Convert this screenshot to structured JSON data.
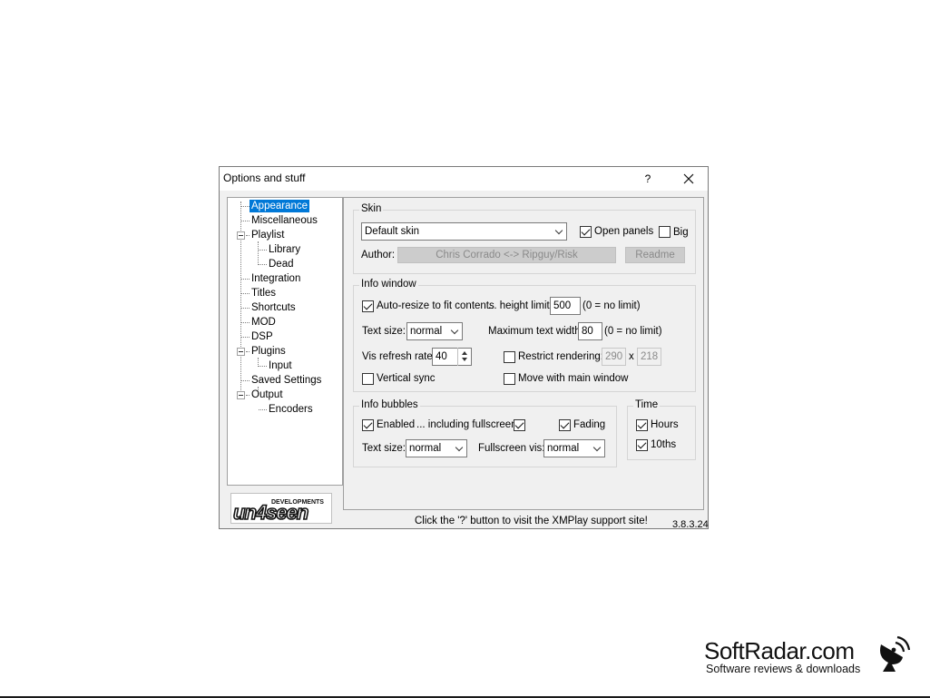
{
  "window": {
    "title": "Options and stuff",
    "help": "?",
    "close": "close"
  },
  "tree": {
    "items": [
      {
        "label": "Appearance",
        "selected": true
      },
      {
        "label": "Miscellaneous"
      },
      {
        "label": "Playlist"
      },
      {
        "label": "Library"
      },
      {
        "label": "Dead"
      },
      {
        "label": "Integration"
      },
      {
        "label": "Titles"
      },
      {
        "label": "Shortcuts"
      },
      {
        "label": "MOD"
      },
      {
        "label": "DSP"
      },
      {
        "label": "Plugins"
      },
      {
        "label": "Input"
      },
      {
        "label": "Saved Settings"
      },
      {
        "label": "Output"
      },
      {
        "label": "Encoders"
      }
    ]
  },
  "logo": {
    "top_text": "DEVELOPMENTS",
    "main_text": "un4seen"
  },
  "skin": {
    "group_label": "Skin",
    "selected": "Default skin",
    "open_panels_label": "Open panels",
    "open_panels_checked": true,
    "big_label": "Big",
    "big_checked": false,
    "author_label": "Author:",
    "author_value": "Chris Corrado <-> Ripguy/Risk",
    "readme_label": "Readme"
  },
  "info_window": {
    "group_label": "Info window",
    "auto_resize_label": "Auto-resize to fit contents",
    "auto_resize_checked": true,
    "height_limit_label": "... height limit:",
    "height_limit_value": "500",
    "no_limit_note": "(0 = no limit)",
    "text_size_label": "Text size:",
    "text_size_value": "normal",
    "max_width_label": "Maximum text width:",
    "max_width_value": "80",
    "max_width_note": "(0 = no limit)",
    "vis_refresh_label": "Vis refresh rate:",
    "vis_refresh_value": "40",
    "restrict_label": "Restrict rendering:",
    "restrict_checked": false,
    "restrict_w": "290",
    "restrict_x": "x",
    "restrict_h": "218",
    "vsync_label": "Vertical sync",
    "vsync_checked": false,
    "move_label": "Move with main window",
    "move_checked": false
  },
  "info_bubbles": {
    "group_label": "Info bubbles",
    "enabled_label": "Enabled",
    "enabled_checked": true,
    "fullscreen_label": "... including fullscreen",
    "fullscreen_checked": true,
    "fading_label": "Fading",
    "fading_checked": true,
    "text_size_label": "Text size:",
    "text_size_value": "normal",
    "fullscreen_vis_label": "Fullscreen vis:",
    "fullscreen_vis_value": "normal"
  },
  "time": {
    "group_label": "Time",
    "hours_label": "Hours",
    "hours_checked": true,
    "tenths_label": "10ths",
    "tenths_checked": true
  },
  "status": {
    "text": "Click the '?' button to visit the XMPlay support site!",
    "version": "3.8.3.24"
  },
  "watermark": {
    "name": "SoftRadar.com",
    "tagline": "Software reviews & downloads"
  }
}
